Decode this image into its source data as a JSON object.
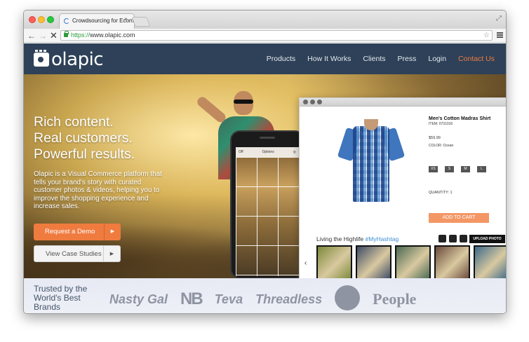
{
  "browser": {
    "tab_title": "Crowdsourcing for Ecomm",
    "tab_close": "×",
    "url_scheme": "https://",
    "url_host": "www.olapic.com",
    "back": "←",
    "forward": "→",
    "stop": "✕",
    "star": "☆",
    "resize": "⤢"
  },
  "site": {
    "logo_text": "olapic",
    "nav": [
      "Products",
      "How It Works",
      "Clients",
      "Press",
      "Login",
      "Contact Us"
    ],
    "hero": {
      "title_lines": [
        "Rich content.",
        "Real customers.",
        "Powerful results."
      ],
      "description": "Olapic is a Visual Commerce platform that tells your brand's story with curated customer photos & videos, helping you to improve the shopping experience and increase sales.",
      "btn_demo": "Request a Demo",
      "btn_case": "View Case Studies",
      "arrow": "▶"
    },
    "phone": {
      "left_label": "Off",
      "center_label": "Options"
    },
    "product": {
      "name": "Men's Cotton Madras Shirt",
      "item": "ITEM: 0731016",
      "price": "$59.99",
      "color": "COLOR: Ocean",
      "sizes": [
        "XS",
        "S",
        "M",
        "L"
      ],
      "quantity": "QUANTITY: 1",
      "add_to_cart": "ADD TO CART"
    },
    "strip": {
      "title": "Living the Highlife",
      "hashtag": "#MyHashtag",
      "upload": "UPLOAD PHOTO",
      "chevron": "‹",
      "thumb_colors": [
        "#7d8a3a",
        "#3f4c66",
        "#4a6a52",
        "#6b4a3c",
        "#3c6a8a"
      ]
    },
    "trusted": {
      "text": "Trusted by the World's Best Brands",
      "brands": [
        "Nasty Gal",
        "NB",
        "Teva",
        "Threadless",
        "People"
      ]
    }
  },
  "colors": {
    "header_bg": "#2e4158",
    "accent_orange": "#f07b3f",
    "hashtag_blue": "#3d8fd2"
  }
}
